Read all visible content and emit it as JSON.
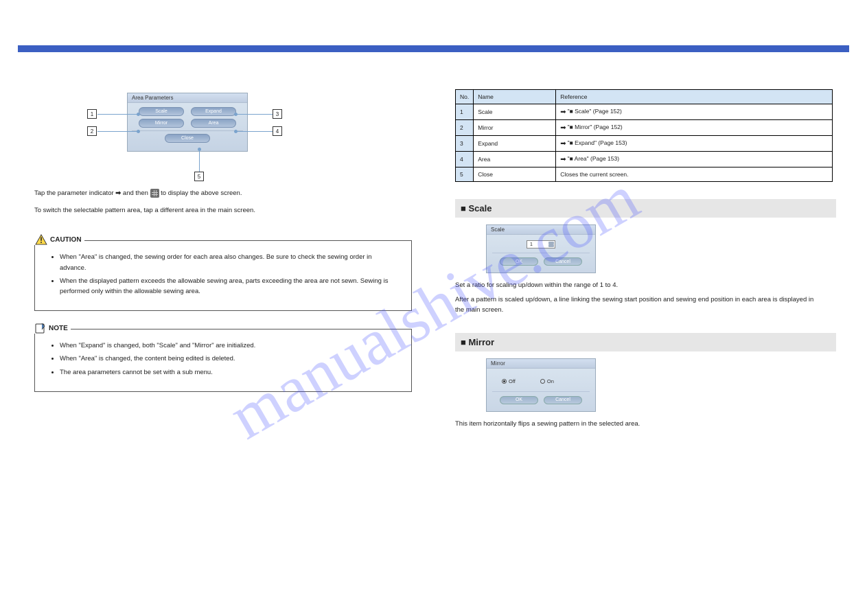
{
  "header": {
    "title": "",
    "page": ""
  },
  "watermark": "manualshive.com",
  "area_params": {
    "title": "Area Parameters",
    "buttons": {
      "scale": "Scale",
      "expand": "Expand",
      "mirror": "Mirror",
      "area": "Area",
      "close": "Close"
    },
    "callouts": {
      "n1": "1",
      "n2": "2",
      "n3": "3",
      "n4": "4",
      "n5": "5"
    }
  },
  "intro": {
    "line1_pre": "Tap the parameter indicator",
    "line1_post": "and then ",
    "line1_end": " to display the above screen.",
    "para2": "To switch the selectable pattern area, tap a different area in the main screen."
  },
  "caution": {
    "title": "CAUTION",
    "items": [
      "When \"Area\" is changed, the sewing order for each area also changes. Be sure to check the sewing order in advance.",
      "When the displayed pattern exceeds the allowable sewing area, parts exceeding the area are not sewn. Sewing is performed only within the allowable sewing area."
    ]
  },
  "note": {
    "title": "NOTE",
    "items": [
      "When \"Expand\" is changed, both \"Scale\" and \"Mirror\" are initialized.",
      "When \"Area\" is changed, the content being edited is deleted.",
      "The area parameters cannot be set with a sub menu."
    ]
  },
  "table": {
    "header_no": "No.",
    "header_name": "Name",
    "header_ref": "Reference",
    "rows": [
      {
        "no": "1",
        "name": "Scale",
        "ref": "\"■ Scale\" (Page 152)"
      },
      {
        "no": "2",
        "name": "Mirror",
        "ref": "\"■ Mirror\" (Page 152)"
      },
      {
        "no": "3",
        "name": "Expand",
        "ref": "\"■ Expand\" (Page 153)"
      },
      {
        "no": "4",
        "name": "Area",
        "ref": "\"■ Area\" (Page 153)"
      },
      {
        "no": "5",
        "name": "Close",
        "ref": "Closes the current screen."
      }
    ]
  },
  "scale": {
    "heading": "Scale",
    "dialog_title": "Scale",
    "value": "1",
    "ok": "OK",
    "cancel": "Cancel",
    "desc1": "Set a ratio for scaling up/down within the range of 1 to 4.",
    "desc2": "After a pattern is scaled up/down, a line linking the sewing start position and sewing end position in each area is displayed in the main screen."
  },
  "mirror": {
    "heading": "Mirror",
    "dialog_title": "Mirror",
    "off": "Off",
    "on": "On",
    "ok": "OK",
    "cancel": "Cancel",
    "desc": "This item horizontally flips a sewing pattern in the selected area."
  },
  "page_number": ""
}
